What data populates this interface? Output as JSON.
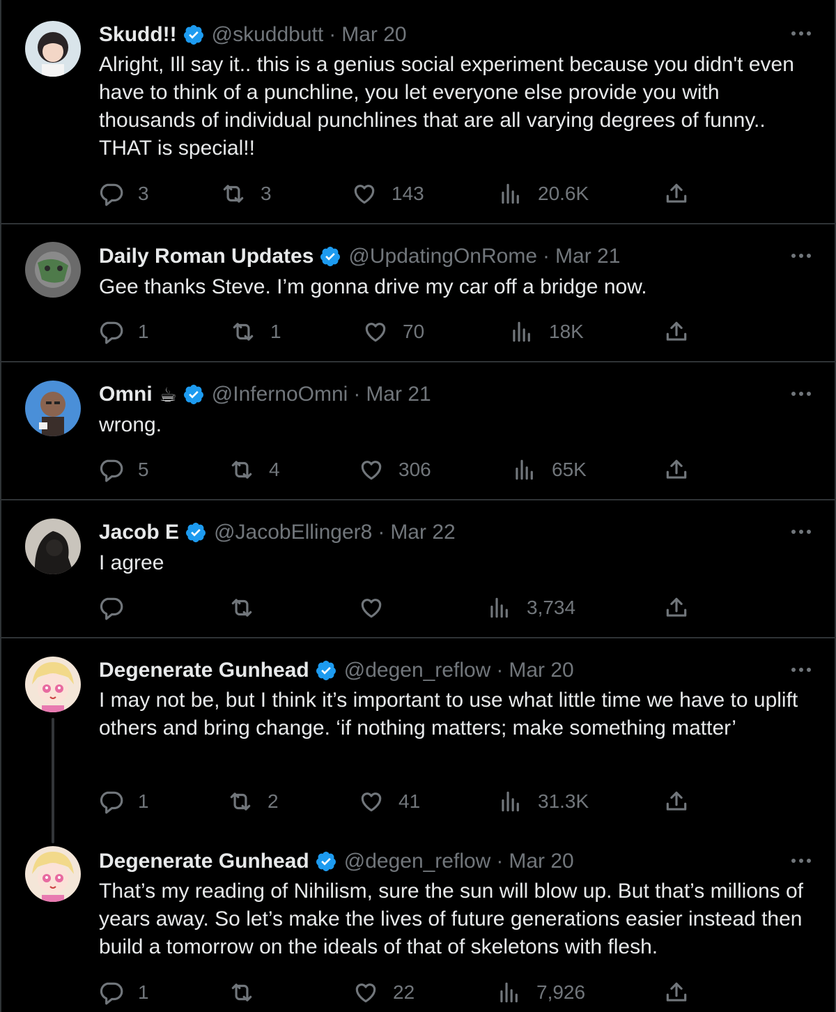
{
  "tweets": [
    {
      "name": "Skudd!!",
      "handle": "@skuddbutt",
      "separator": "·",
      "date": "Mar 20",
      "text": "Alright, Ill say it.. this is a genius social experiment because you didn't even have to think of a punchline, you let everyone else provide you with thousands of individual punchlines that are all varying degrees of funny.. THAT is special!!",
      "replies": "3",
      "reposts": "3",
      "likes": "143",
      "views": "20.6K"
    },
    {
      "name": "Daily Roman Updates",
      "handle": "@UpdatingOnRome",
      "separator": "·",
      "date": "Mar 21",
      "text": "Gee thanks Steve. I’m gonna drive my car off a bridge now.",
      "replies": "1",
      "reposts": "1",
      "likes": "70",
      "views": "18K"
    },
    {
      "name": "Omni",
      "emoji": "☕",
      "handle": "@InfernoOmni",
      "separator": "·",
      "date": "Mar 21",
      "text": "wrong.",
      "replies": "5",
      "reposts": "4",
      "likes": "306",
      "views": "65K"
    },
    {
      "name": "Jacob E",
      "handle": "@JacobEllinger8",
      "separator": "·",
      "date": "Mar 22",
      "text": "I agree",
      "replies": "",
      "reposts": "",
      "likes": "",
      "views": "3,734"
    },
    {
      "name": "Degenerate Gunhead",
      "handle": "@degen_reflow",
      "separator": "·",
      "date": "Mar 20",
      "text": "I may not be, but I think it’s important to use what little time we have to uplift others and bring change. ‘if nothing matters; make something matter’",
      "replies": "1",
      "reposts": "2",
      "likes": "41",
      "views": "31.3K"
    },
    {
      "name": "Degenerate Gunhead",
      "handle": "@degen_reflow",
      "separator": "·",
      "date": "Mar 20",
      "text": "That’s my reading of Nihilism, sure the sun will blow up. But that’s millions of years away. So let’s make the lives of future generations easier instead then build a tomorrow on the ideals of that of skeletons with flesh.",
      "replies": "1",
      "reposts": "",
      "likes": "22",
      "views": "7,926"
    }
  ],
  "icons": {
    "reply": "reply-icon",
    "repost": "repost-icon",
    "like": "heart-icon",
    "views": "views-icon",
    "share": "share-icon",
    "more": "more-icon",
    "verified": "verified-badge-icon"
  },
  "colors": {
    "background": "#000000",
    "text": "#e7e9ea",
    "muted": "#71767b",
    "verified": "#1d9bf0",
    "divider": "#2f3336"
  }
}
